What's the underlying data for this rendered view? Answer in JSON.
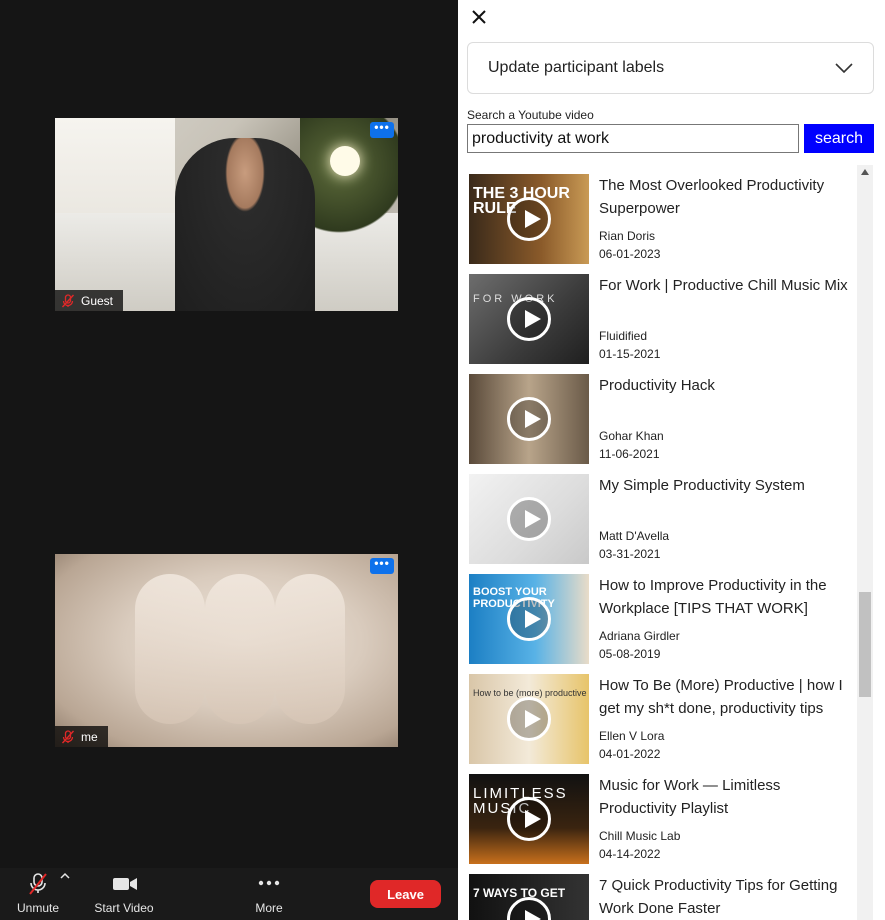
{
  "meeting": {
    "tiles": [
      {
        "name": "Guest"
      },
      {
        "name": "me"
      }
    ],
    "more_glyph": "•••",
    "toolbar": {
      "unmute": "Unmute",
      "start_video": "Start Video",
      "more": "More",
      "leave": "Leave"
    }
  },
  "panel": {
    "accordion_title": "Update participant labels",
    "search_label": "Search a Youtube video",
    "search_value": "productivity at work",
    "search_button": "search",
    "results": [
      {
        "title": "The Most Overlooked Productivity Superpower",
        "channel": "Rian Doris",
        "date": "06-01-2023",
        "thumb_text": "THE 3 HOUR RULE"
      },
      {
        "title": "For Work | Productive Chill Music Mix",
        "channel": "Fluidified",
        "date": "01-15-2021",
        "thumb_text": "FOR WORK"
      },
      {
        "title": "Productivity Hack",
        "channel": "Gohar Khan",
        "date": "11-06-2021",
        "thumb_text": ""
      },
      {
        "title": "My Simple Productivity System",
        "channel": "Matt D'Avella",
        "date": "03-31-2021",
        "thumb_text": ""
      },
      {
        "title": "How to Improve Productivity in the Workplace [TIPS THAT WORK]",
        "channel": "Adriana Girdler",
        "date": "05-08-2019",
        "thumb_text": "BOOST YOUR PRODUCTIVITY"
      },
      {
        "title": "How To Be (More) Productive | how I get my sh*t done, productivity tips",
        "channel": "Ellen V Lora",
        "date": "04-01-2022",
        "thumb_text": "How to be (more) productive"
      },
      {
        "title": "Music for Work — Limitless Productivity Playlist",
        "channel": "Chill Music Lab",
        "date": "04-14-2022",
        "thumb_text": "LIMITLESS MUSIC"
      },
      {
        "title": "7 Quick Productivity Tips for Getting Work Done Faster",
        "channel": "",
        "date": "",
        "thumb_text": "7 WAYS TO GET"
      }
    ]
  },
  "colors": {
    "search_button": "#0000ff",
    "leave_button": "#e02828",
    "tile_menu": "#0e71eb",
    "meeting_bg": "#151515"
  }
}
